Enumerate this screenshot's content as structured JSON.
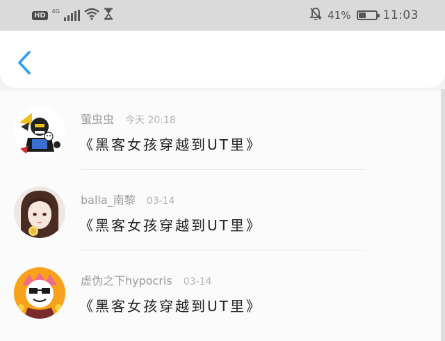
{
  "status_bar": {
    "hd_label": "HD",
    "network_label": "4G",
    "battery_percent": "41%",
    "battery_level": 0.41,
    "time": "11:03",
    "icons": [
      "hd-icon",
      "signal-icon",
      "wifi-icon",
      "hourglass-icon",
      "mute-bell-icon",
      "battery-icon"
    ]
  },
  "header": {
    "back_icon": "chevron-left-icon",
    "accent_color": "#2a9df4"
  },
  "comments": [
    {
      "username": "萤虫虫",
      "time": "今天 20:18",
      "text": "《黑客女孩穿越到UT里》"
    },
    {
      "username": "balla_南黎",
      "time": "03-14",
      "text": "《黑客女孩穿越到UT里》"
    },
    {
      "username": "虚伪之下hypocris",
      "time": "03-14",
      "text": "《黑客女孩穿越到UT里》"
    }
  ]
}
